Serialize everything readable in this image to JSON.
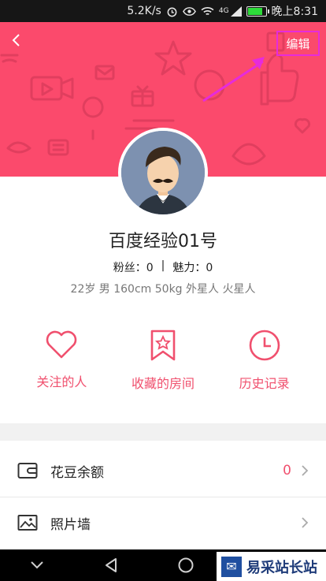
{
  "status_bar": {
    "network_speed": "5.2K/s",
    "signal_label": "4G",
    "time": "晚上8:31",
    "battery_level": 0.85
  },
  "header": {
    "edit_label": "编辑"
  },
  "profile": {
    "name": "百度经验01号",
    "fans_label": "粉丝：",
    "fans_count": "0",
    "separator": "|",
    "charm_label": "魅力：",
    "charm_count": "0",
    "info": "22岁 男 160cm 50kg 外星人  火星人"
  },
  "actions": [
    {
      "label": "关注的人",
      "icon": "heart-icon"
    },
    {
      "label": "收藏的房间",
      "icon": "bookmark-star-icon"
    },
    {
      "label": "历史记录",
      "icon": "clock-icon"
    }
  ],
  "menu": [
    {
      "label": "花豆余额",
      "value": "0",
      "icon": "wallet-icon"
    },
    {
      "label": "照片墙",
      "value": "",
      "icon": "image-icon"
    }
  ],
  "watermark": {
    "text": "易采站长站"
  },
  "colors": {
    "accent": "#fb4a6c",
    "action_text": "#f0506e",
    "highlight": "#e62bdc"
  }
}
